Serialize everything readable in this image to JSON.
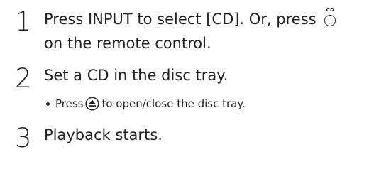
{
  "steps": [
    {
      "number": "1",
      "line1": "Press INPUT to select [CD]. Or, press",
      "line2": "on the remote control.",
      "button_label": "CD"
    },
    {
      "number": "2",
      "line1": "Set a CD in the disc tray.",
      "bullet": {
        "before": "Press",
        "after": "to open/close the disc tray.",
        "icon": "eject-icon"
      }
    },
    {
      "number": "3",
      "line1": "Playback starts."
    }
  ]
}
